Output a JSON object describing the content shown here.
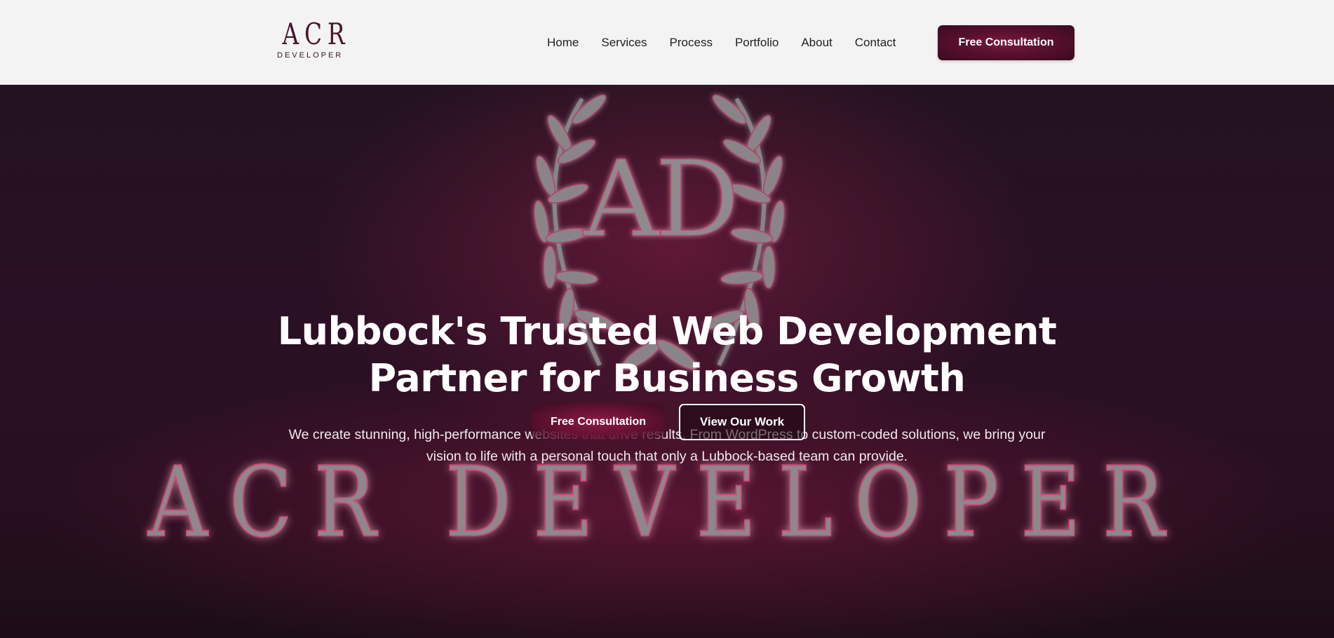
{
  "brand": {
    "logo_mark": "ACR",
    "logo_sub": "DEVELOPER",
    "emblem_monogram": "AD",
    "background_wordmark": "ACR DEVELOPER"
  },
  "nav": {
    "items": [
      "Home",
      "Services",
      "Process",
      "Portfolio",
      "About",
      "Contact"
    ],
    "cta_label": "Free Consultation"
  },
  "hero": {
    "title_line1": "Lubbock's Trusted Web Development",
    "title_line2": "Partner for Business Growth",
    "description_line1": "We create stunning, high-performance websites that drive results. From WordPress to custom-coded solutions, we bring your",
    "description_line2": "vision to life with a personal touch that only a Lubbock-based team can provide.",
    "primary_button": "Free Consultation",
    "secondary_button": "View Our Work"
  },
  "colors": {
    "brand": "#5a1030",
    "header_bg": "#f3f3f3",
    "hero_bg": "#2b1024",
    "text_light": "#ffffff"
  }
}
